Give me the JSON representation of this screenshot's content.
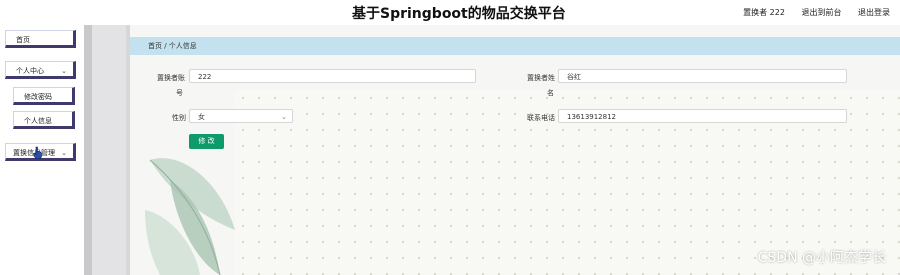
{
  "header": {
    "title": "基于Springboot的物品交换平台",
    "user": "置换者 222",
    "back_to_front": "退出到前台",
    "logout": "退出登录"
  },
  "sidebar": {
    "items": [
      {
        "label": "首页",
        "has_chevron": false
      },
      {
        "label": "个人中心",
        "has_chevron": true
      },
      {
        "label": "修改密码",
        "has_chevron": false
      },
      {
        "label": "个人信息",
        "has_chevron": false
      },
      {
        "label": "置换信息管理",
        "has_chevron": true
      }
    ],
    "chevron_icon": "chevron-down-icon"
  },
  "breadcrumb": {
    "text": "首页 / 个人信息"
  },
  "form": {
    "account_label": "置换者账",
    "account_label_wrap": "号",
    "account_value": "222",
    "name_label": "置换者姓",
    "name_label_wrap": "名",
    "name_value": "谷红",
    "gender_label": "性别",
    "gender_value": "女",
    "phone_label": "联系电话",
    "phone_value": "13613912812",
    "submit_label": "修 改"
  },
  "watermark": "CSDN @小阿杰学长",
  "colors": {
    "breadcrumb_bg": "#c3e1ef",
    "button_green": "#0f9a6b",
    "sidebar_accent": "#3e3a6e"
  }
}
